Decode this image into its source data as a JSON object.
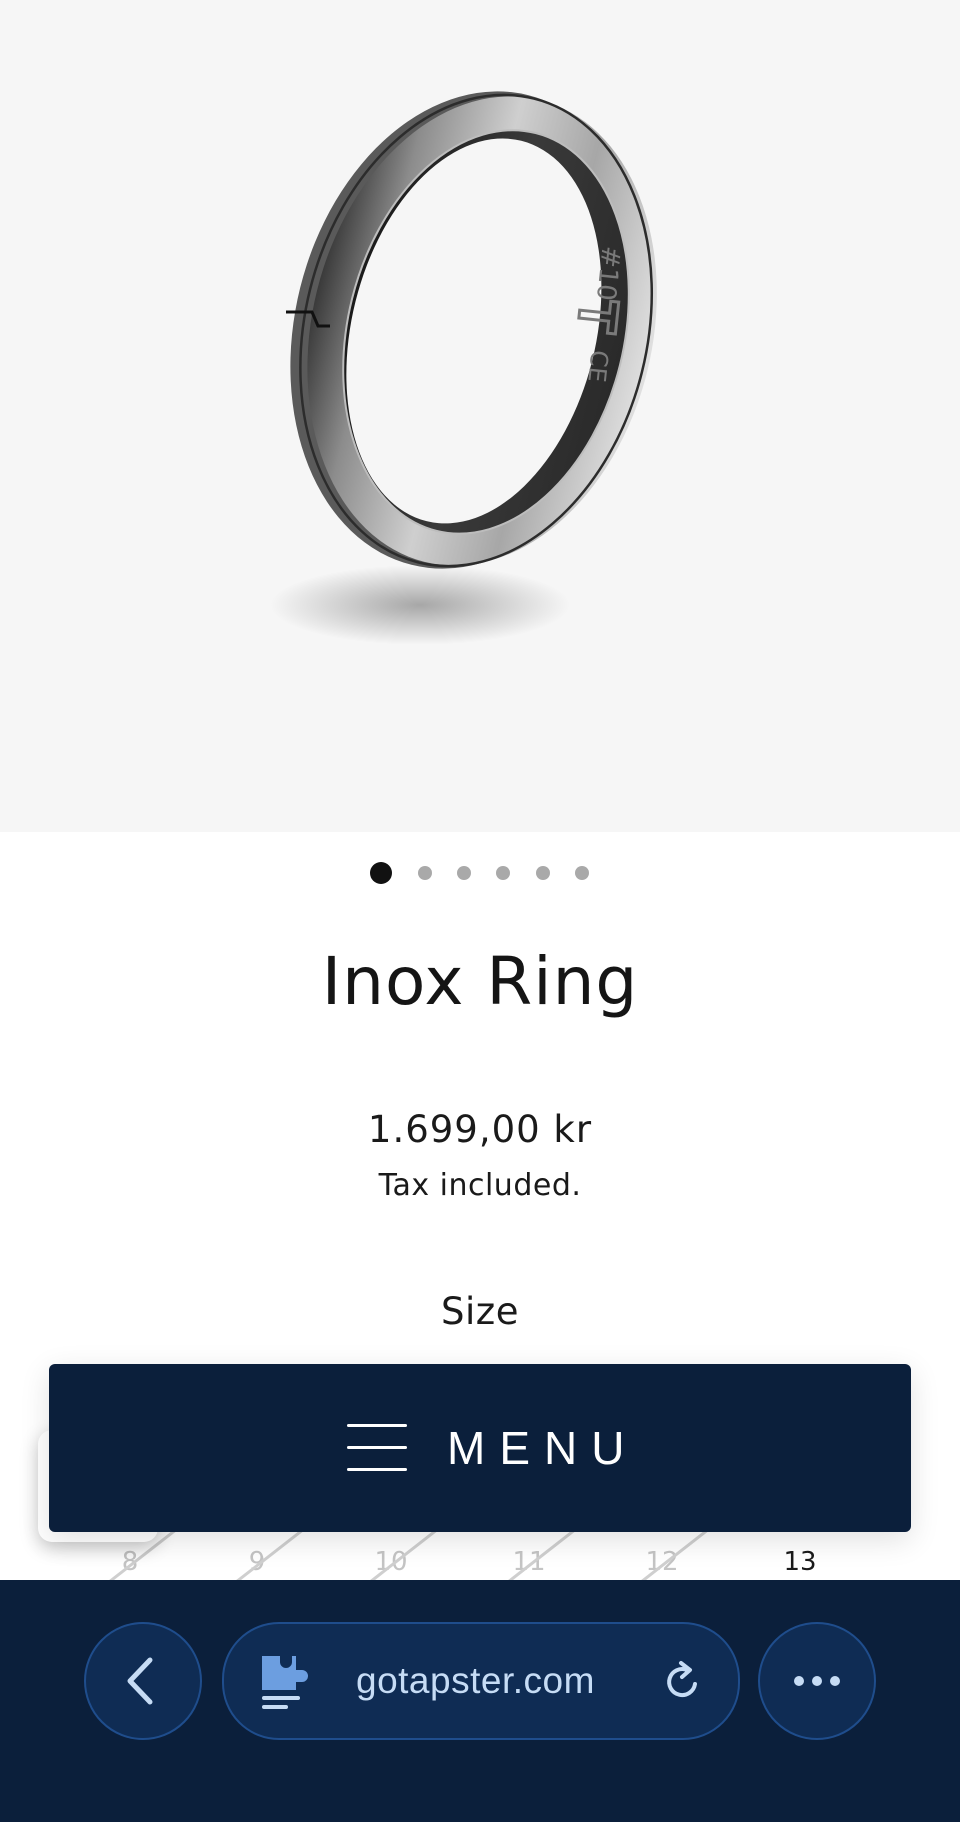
{
  "product": {
    "title": "Inox Ring",
    "price": "1.699,00 kr",
    "tax_note": "Tax included.",
    "size_label": "Size",
    "sizes": [
      {
        "label": "8",
        "available": false
      },
      {
        "label": "9",
        "available": false
      },
      {
        "label": "10",
        "available": false
      },
      {
        "label": "11",
        "available": false
      },
      {
        "label": "12",
        "available": false
      },
      {
        "label": "13",
        "available": true
      }
    ]
  },
  "gallery": {
    "image_count": 6,
    "active_index": 0,
    "ring_engraving": "#10",
    "ring_marks": "CE"
  },
  "menu": {
    "label": "MENU",
    "icon": "hamburger-icon"
  },
  "browser": {
    "url": "gotapster.com",
    "back_icon": "chevron-left-icon",
    "site_icon": "puzzle-page-icon",
    "reload_icon": "reload-icon",
    "more_icon": "more-horizontal-icon"
  },
  "colors": {
    "accent": "#0b1f3b",
    "browser_control": "#0f2c54",
    "browser_border": "#1f4d8c",
    "url_text": "#c6dcf5",
    "image_background": "#f6f6f6"
  }
}
